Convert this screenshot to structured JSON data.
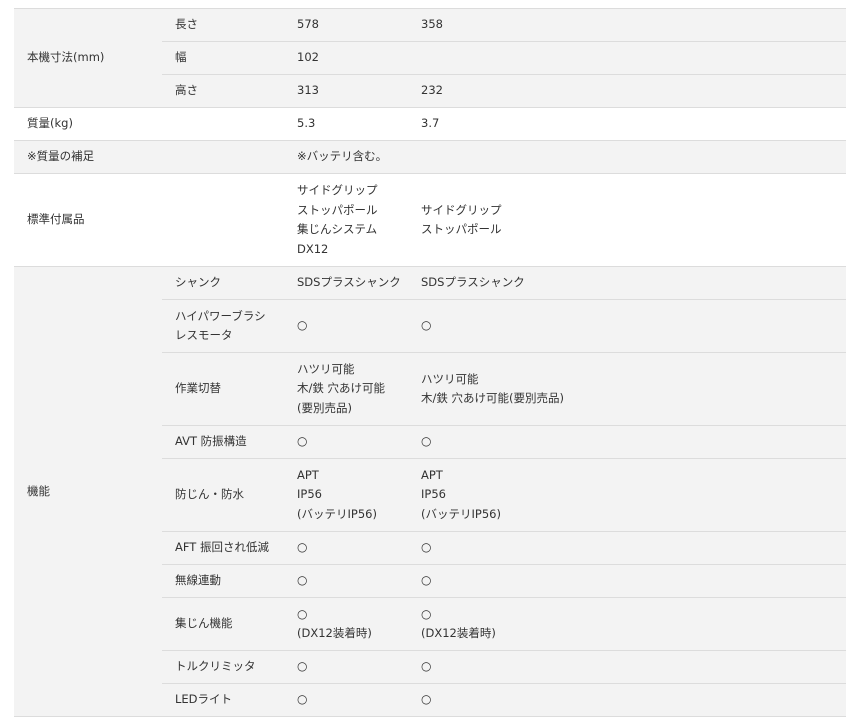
{
  "table": {
    "dimensions": {
      "label": "本機寸法(mm)",
      "rows": [
        {
          "label": "長さ",
          "a": "578",
          "b": "358"
        },
        {
          "label": "幅",
          "a": "102",
          "b": ""
        },
        {
          "label": "高さ",
          "a": "313",
          "b": "232"
        }
      ]
    },
    "mass": {
      "label": "質量(kg)",
      "a": "5.3",
      "b": "3.7"
    },
    "mass_note": {
      "label": "※質量の補足",
      "a": "※バッテリ含む。"
    },
    "accessories": {
      "label": "標準付属品",
      "a": [
        "サイドグリップ",
        "ストッパポール",
        "集じんシステム",
        "DX12"
      ],
      "b": [
        "サイドグリップ",
        "ストッパポール"
      ]
    },
    "features": {
      "label": "機能",
      "rows": [
        {
          "label": [
            "シャンク"
          ],
          "a": [
            "SDSプラスシャンク"
          ],
          "b": [
            "SDSプラスシャンク"
          ]
        },
        {
          "label": [
            "ハイパワーブラシ",
            "レスモータ"
          ],
          "a": [
            "○"
          ],
          "b": [
            "○"
          ]
        },
        {
          "label": [
            "作業切替"
          ],
          "a": [
            "ハツリ可能",
            "木/鉄 穴あけ可能",
            "(要別売品)"
          ],
          "b": [
            "ハツリ可能",
            "木/鉄 穴あけ可能(要別売品)"
          ]
        },
        {
          "label": [
            "AVT 防振構造"
          ],
          "a": [
            "○"
          ],
          "b": [
            "○"
          ]
        },
        {
          "label": [
            "防じん・防水"
          ],
          "a": [
            "APT",
            "IP56",
            "(バッテリIP56)"
          ],
          "b": [
            "APT",
            "IP56",
            "(バッテリIP56)"
          ]
        },
        {
          "label": [
            "AFT 振回され低減"
          ],
          "a": [
            "○"
          ],
          "b": [
            "○"
          ]
        },
        {
          "label": [
            "無線連動"
          ],
          "a": [
            "○"
          ],
          "b": [
            "○"
          ]
        },
        {
          "label": [
            "集じん機能"
          ],
          "a": [
            "○",
            "(DX12装着時)"
          ],
          "b": [
            "○",
            "(DX12装着時)"
          ]
        },
        {
          "label": [
            "トルクリミッタ"
          ],
          "a": [
            "○"
          ],
          "b": [
            "○"
          ]
        },
        {
          "label": [
            "LEDライト"
          ],
          "a": [
            "○"
          ],
          "b": [
            "○"
          ]
        }
      ]
    }
  }
}
